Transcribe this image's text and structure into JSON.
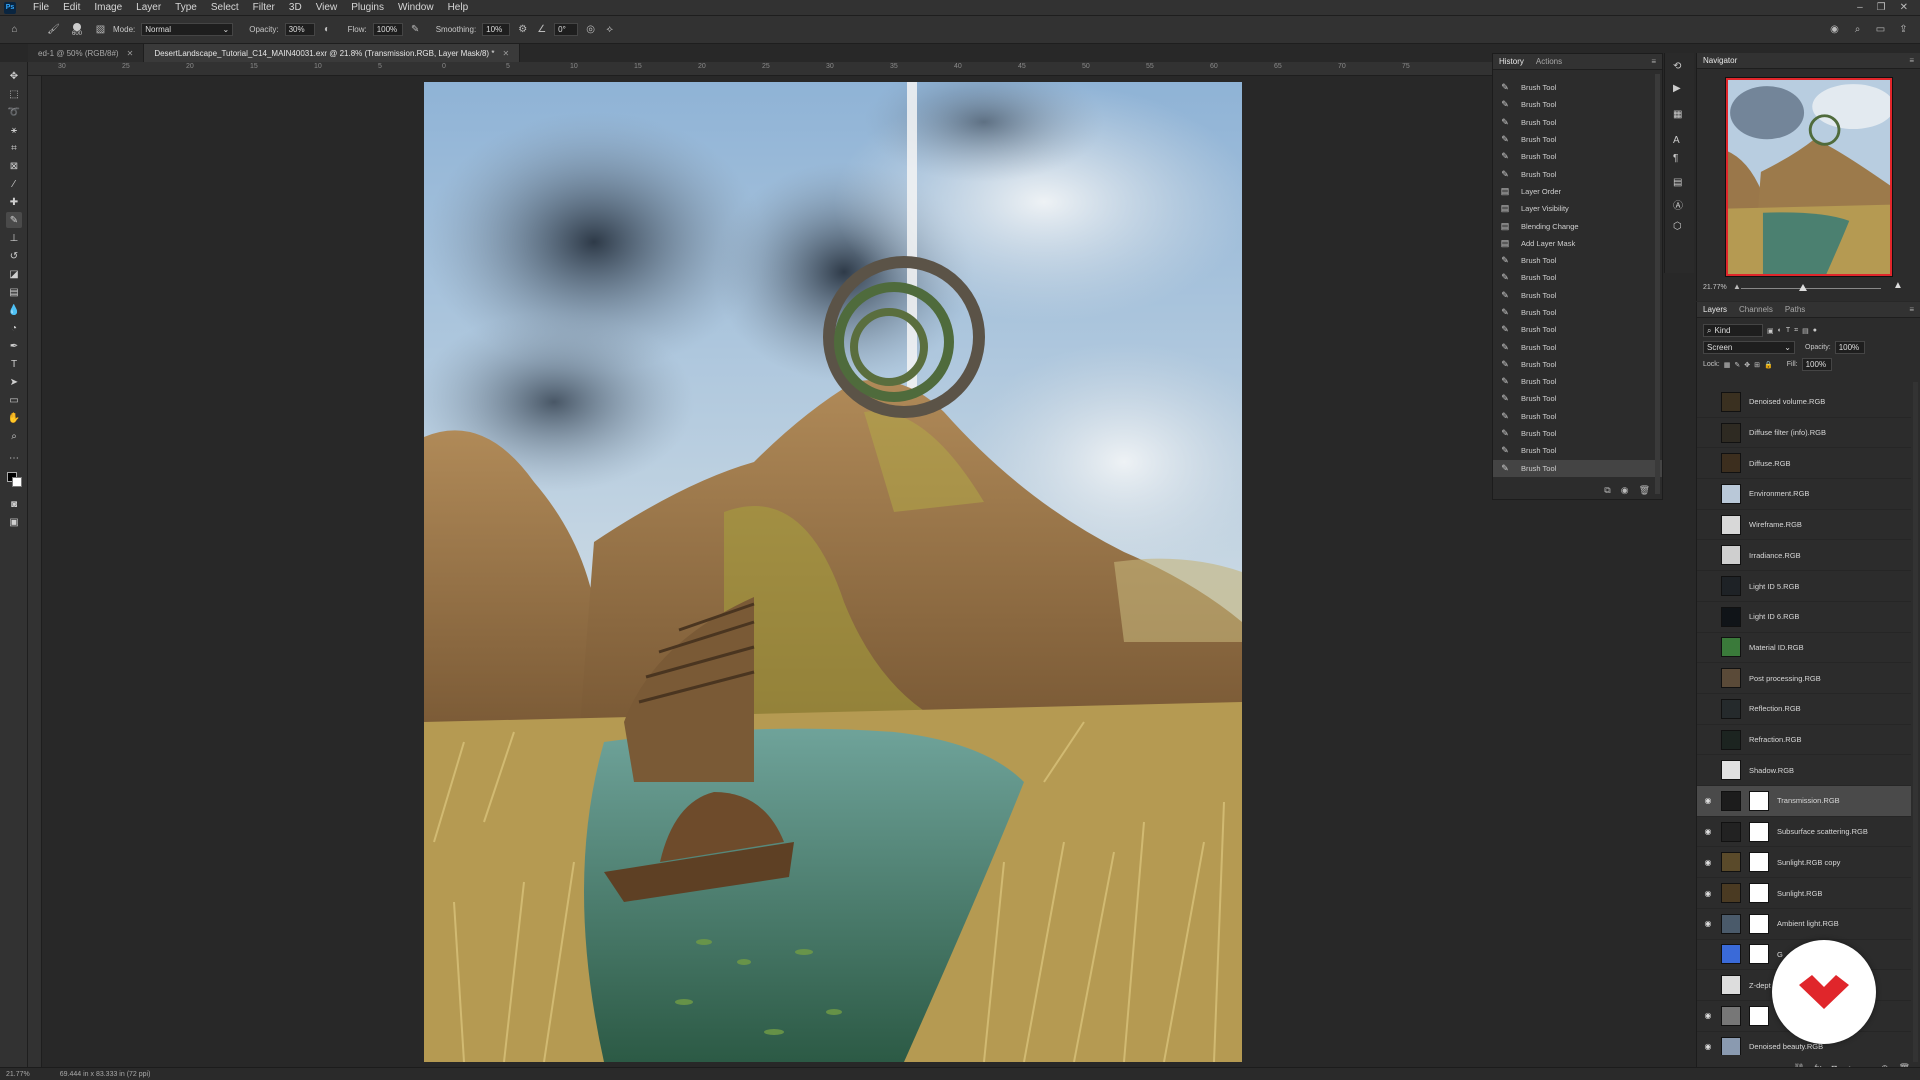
{
  "menubar": {
    "app_icon": "Ps",
    "items": [
      "File",
      "Edit",
      "Image",
      "Layer",
      "Type",
      "Select",
      "Filter",
      "3D",
      "View",
      "Plugins",
      "Window",
      "Help"
    ],
    "window_controls": [
      "–",
      "❐",
      "✕"
    ]
  },
  "options": {
    "brush_size": "600",
    "mode_label": "Mode:",
    "mode_value": "Normal",
    "opacity_label": "Opacity:",
    "opacity_value": "30%",
    "flow_label": "Flow:",
    "flow_value": "100%",
    "smoothing_label": "Smoothing:",
    "smoothing_value": "10%",
    "angle_value": "0°"
  },
  "tabs": [
    {
      "label": "ed-1 @ 50% (RGB/8#)"
    },
    {
      "label": "DesertLandscape_Tutorial_C14_MAIN40031.exr @ 21.8% (Transmission.RGB, Layer Mask/8) *"
    }
  ],
  "ruler_top_labels": [
    "30",
    "25",
    "20",
    "15",
    "10",
    "5",
    "0",
    "5",
    "10",
    "15",
    "20",
    "25",
    "30",
    "35",
    "40",
    "45",
    "50",
    "55",
    "60",
    "65",
    "70",
    "75"
  ],
  "history": {
    "tab_history": "History",
    "tab_actions": "Actions",
    "items": [
      "Brush Tool",
      "Brush Tool",
      "Brush Tool",
      "Brush Tool",
      "Brush Tool",
      "Brush Tool",
      "Layer Order",
      "Layer Visibility",
      "Blending Change",
      "Add Layer Mask",
      "Brush Tool",
      "Brush Tool",
      "Brush Tool",
      "Brush Tool",
      "Brush Tool",
      "Brush Tool",
      "Brush Tool",
      "Brush Tool",
      "Brush Tool",
      "Brush Tool",
      "Brush Tool",
      "Brush Tool",
      "Brush Tool"
    ]
  },
  "navigator": {
    "title": "Navigator",
    "zoom": "21.77%"
  },
  "layers": {
    "tab_layers": "Layers",
    "tab_channels": "Channels",
    "tab_paths": "Paths",
    "kind_label": "Kind",
    "blend_mode": "Screen",
    "opacity_label": "Opacity:",
    "opacity_value": "100%",
    "lock_label": "Lock:",
    "fill_label": "Fill:",
    "fill_value": "100%",
    "items": [
      {
        "name": "Denoised volume.RGB",
        "visible": false,
        "mask": false
      },
      {
        "name": "Diffuse filter (info).RGB",
        "visible": false,
        "mask": false
      },
      {
        "name": "Diffuse.RGB",
        "visible": false,
        "mask": false
      },
      {
        "name": "Environment.RGB",
        "visible": false,
        "mask": false
      },
      {
        "name": "Wireframe.RGB",
        "visible": false,
        "mask": false
      },
      {
        "name": "Irradiance.RGB",
        "visible": false,
        "mask": false
      },
      {
        "name": "Light ID 5.RGB",
        "visible": false,
        "mask": false
      },
      {
        "name": "Light ID 6.RGB",
        "visible": false,
        "mask": false
      },
      {
        "name": "Material ID.RGB",
        "visible": false,
        "mask": false
      },
      {
        "name": "Post processing.RGB",
        "visible": false,
        "mask": false
      },
      {
        "name": "Reflection.RGB",
        "visible": false,
        "mask": false
      },
      {
        "name": "Refraction.RGB",
        "visible": false,
        "mask": false
      },
      {
        "name": "Shadow.RGB",
        "visible": false,
        "mask": false
      },
      {
        "name": "Transmission.RGB",
        "visible": true,
        "mask": true
      },
      {
        "name": "Subsurface scattering.RGB",
        "visible": true,
        "mask": true
      },
      {
        "name": "Sunlight.RGB copy",
        "visible": true,
        "mask": true
      },
      {
        "name": "Sunlight.RGB",
        "visible": true,
        "mask": true
      },
      {
        "name": "Ambient light.RGB",
        "visible": true,
        "mask": true
      },
      {
        "name": "G",
        "visible": false,
        "mask": true
      },
      {
        "name": "Z-dept",
        "visible": false,
        "mask": false
      },
      {
        "name": "",
        "visible": true,
        "mask": true
      },
      {
        "name": "Denoised beauty.RGB",
        "visible": true,
        "mask": false
      }
    ]
  },
  "status": {
    "zoom": "21.77%",
    "doc_size": "69.444 in x 83.333 in (72 ppi)"
  },
  "colors": {
    "accent_red": "#e0262b",
    "selected_layer": "#4a4a4a",
    "panel_bg": "#2c2c2c"
  }
}
